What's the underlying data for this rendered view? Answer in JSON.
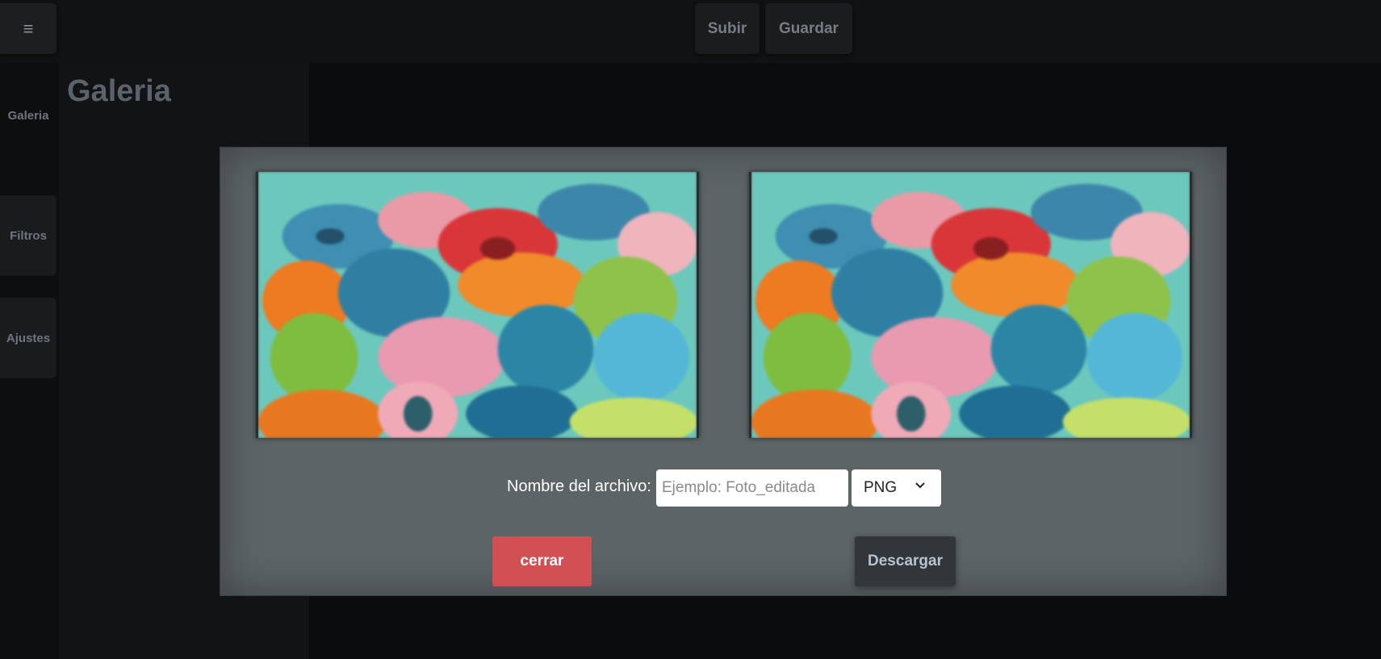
{
  "topbar": {
    "menu_icon": "hamburger-icon",
    "menu_glyph": "≡",
    "buttons": [
      "Subir",
      "Guardar"
    ]
  },
  "sidebar": {
    "items": [
      {
        "label": "Galeria"
      },
      {
        "label": "Filtros"
      },
      {
        "label": "Ajustes"
      }
    ]
  },
  "page": {
    "title": "Galeria"
  },
  "modal": {
    "filename_label": "Nombre del archivo:",
    "filename_value": "",
    "filename_placeholder": "Ejemplo: Foto_editada",
    "format_selected": "PNG",
    "close_label": "cerrar",
    "download_label": "Descargar"
  },
  "colors": {
    "close_button": "#d24f53",
    "modal_bg": "#5d6466",
    "page_bg": "#0b0c0d"
  }
}
